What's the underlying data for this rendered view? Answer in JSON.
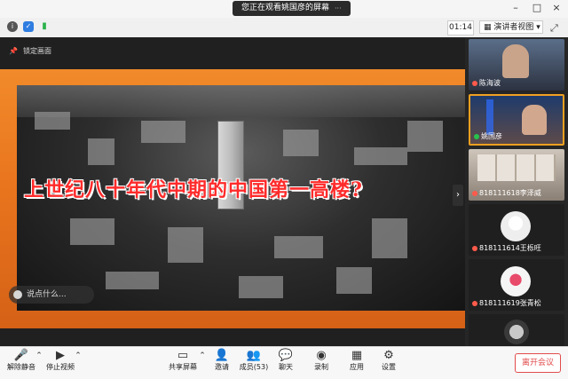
{
  "window": {
    "share_banner": "您正在观看姚国彦的屏幕",
    "more_icon": "···"
  },
  "toolbar": {
    "timer": "01:14",
    "view_mode": "演讲者视图"
  },
  "stage": {
    "lock_label": "锁定画面",
    "slide_title": "上世纪八十年代中期的中国第一高楼?",
    "comment_placeholder": "说点什么..."
  },
  "participants": [
    {
      "name": "陈海波",
      "mic": "muted"
    },
    {
      "name": "姚国彦",
      "mic": "on"
    },
    {
      "name": "818111618李泽威",
      "mic": "muted"
    },
    {
      "name": "818111614王栎旺",
      "mic": "muted"
    },
    {
      "name": "818111619张青松",
      "mic": "muted"
    },
    {
      "name": "",
      "mic": "muted"
    }
  ],
  "bottom": {
    "unmute": "解除静音",
    "stop_video": "停止视频",
    "share_screen": "共享屏幕",
    "invite": "邀请",
    "members": "成员(53)",
    "chat": "聊天",
    "record": "录制",
    "apps": "应用",
    "settings": "设置",
    "leave": "离开会议"
  },
  "colors": {
    "accent_orange": "#e9751e",
    "slide_text_red": "#ff2b2b",
    "leave_red": "#e24b4b"
  }
}
